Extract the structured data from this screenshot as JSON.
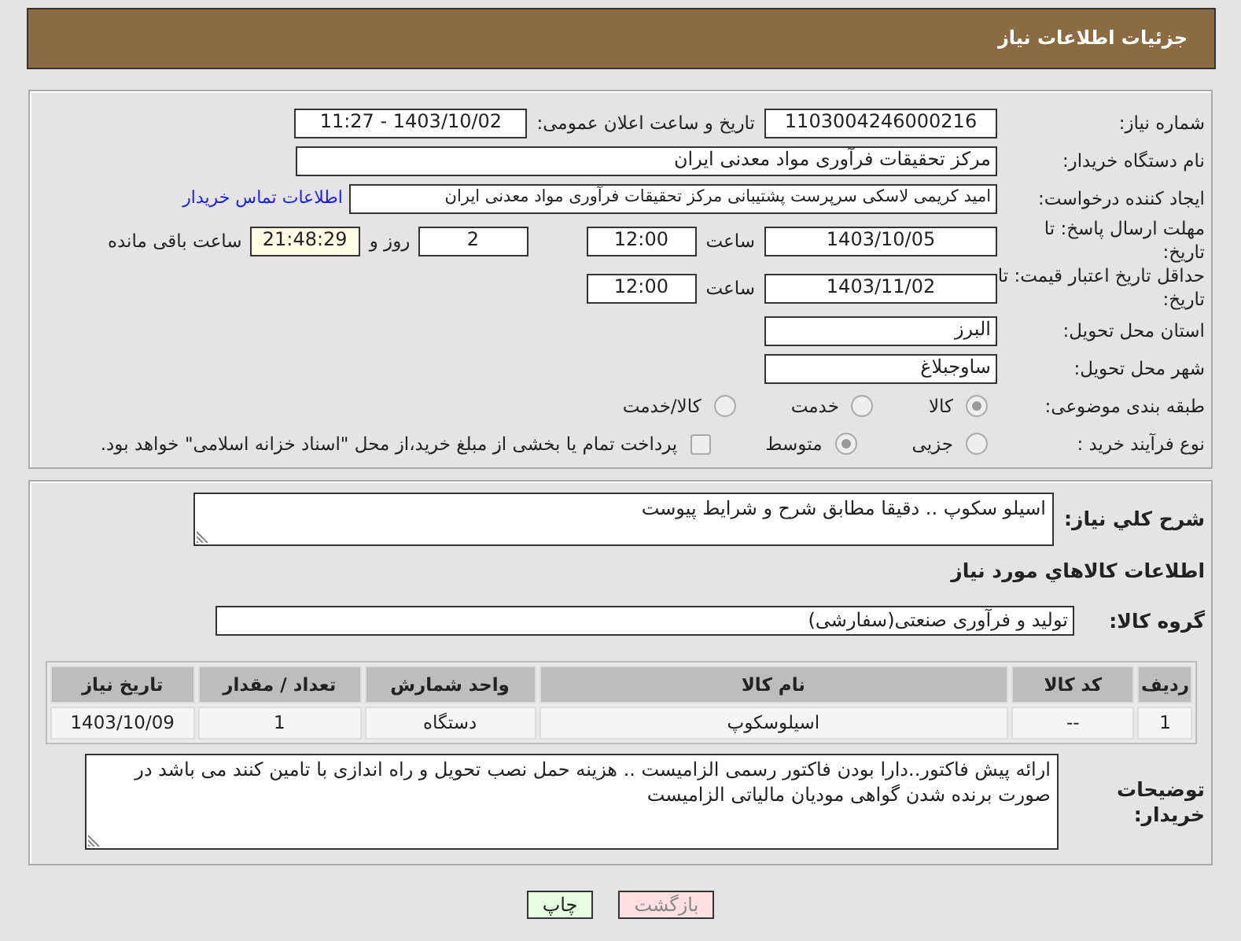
{
  "title": "جزئیات اطلاعات نیاز",
  "need_number": {
    "label": "شماره نیاز:",
    "value": "1103004246000216"
  },
  "announce": {
    "label": "تاریخ و ساعت اعلان عمومی:",
    "value": "1403/10/02 - 11:27"
  },
  "buyer_org": {
    "label": "نام دستگاه خریدار:",
    "value": "مرکز تحقیقات فرآوری مواد معدنی ایران"
  },
  "requester": {
    "label": "ایجاد کننده درخواست:",
    "value": "امید کریمی لاسکی سرپرست پشتیبانی مرکز تحقیقات فرآوری مواد معدنی ایران",
    "link": "اطلاعات تماس خریدار"
  },
  "deadline": {
    "label": "مهلت ارسال پاسخ: تا تاریخ:",
    "date": "1403/10/05",
    "time_label": "ساعت",
    "time": "12:00",
    "days": "2",
    "days_label": "روز و",
    "remaining": "21:48:29",
    "remaining_label": "ساعت باقی مانده"
  },
  "validity": {
    "label": "حداقل تاریخ اعتبار قیمت: تا تاریخ:",
    "date": "1403/11/02",
    "time_label": "ساعت",
    "time": "12:00"
  },
  "province": {
    "label": "استان محل تحویل:",
    "value": "البرز"
  },
  "city": {
    "label": "شهر محل تحویل:",
    "value": "ساوجبلاغ"
  },
  "category": {
    "label": "طبقه بندی موضوعی:",
    "options": [
      {
        "label": "کالا",
        "selected": true
      },
      {
        "label": "خدمت",
        "selected": false
      },
      {
        "label": "کالا/خدمت",
        "selected": false
      }
    ]
  },
  "process": {
    "label": "نوع فرآیند خرید :",
    "options": [
      {
        "label": "جزیی",
        "selected": false
      },
      {
        "label": "متوسط",
        "selected": true
      }
    ],
    "payment": {
      "checked": false,
      "text": "پرداخت تمام یا بخشی از مبلغ خرید،از محل \"اسناد خزانه اسلامی\" خواهد بود."
    }
  },
  "description": {
    "label": "شرح کلي نياز:",
    "value": "اسیلو سکوپ .. دقیقا مطابق شرح و شرایط پیوست"
  },
  "goods_heading": "اطلاعات کالاهاي مورد نياز",
  "goods_group": {
    "label": "گروه کالا:",
    "value": "تولید و فرآوری صنعتی(سفارشی)"
  },
  "table": {
    "columns": [
      "ردیف",
      "کد کالا",
      "نام کالا",
      "واحد شمارش",
      "تعداد / مقدار",
      "تاریخ نیاز"
    ],
    "rows": [
      [
        "1",
        "--",
        "اسیلوسکوپ",
        "دستگاه",
        "1",
        "1403/10/09"
      ]
    ]
  },
  "buyer_notes": {
    "label": "توضیحات خریدار:",
    "value": "ارائه پیش فاکتور..دارا بودن فاکتور رسمی الزامیست .. هزینه حمل نصب تحویل و راه اندازی با تامین کنند می باشد در صورت برنده شدن گواهی مودیان مالیاتی الزامیست"
  },
  "buttons": [
    {
      "label": "بازگشت",
      "kind": "back"
    },
    {
      "label": "چاپ",
      "kind": "print"
    }
  ]
}
